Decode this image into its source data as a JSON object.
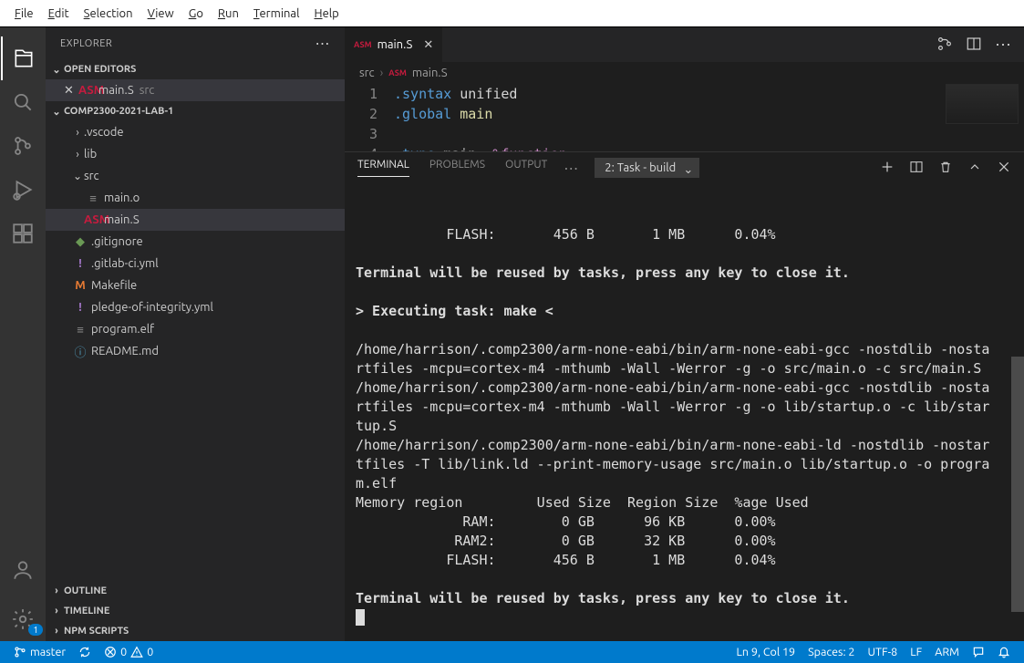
{
  "menubar": [
    "File",
    "Edit",
    "Selection",
    "View",
    "Go",
    "Run",
    "Terminal",
    "Help"
  ],
  "explorer": {
    "title": "EXPLORER",
    "openEditorsLabel": "OPEN EDITORS",
    "openEditors": [
      {
        "name": "main.S",
        "dir": "src",
        "iconClass": "ic-asm",
        "iconText": "ASM"
      }
    ],
    "rootName": "COMP2300-2021-LAB-1",
    "tree": [
      {
        "type": "folder",
        "name": ".vscode",
        "indent": 1,
        "expanded": false
      },
      {
        "type": "folder",
        "name": "lib",
        "indent": 1,
        "expanded": false
      },
      {
        "type": "folder",
        "name": "src",
        "indent": 1,
        "expanded": true
      },
      {
        "type": "file",
        "name": "main.o",
        "indent": 2,
        "iconClass": "ic-file",
        "iconText": "≡"
      },
      {
        "type": "file",
        "name": "main.S",
        "indent": 2,
        "iconClass": "ic-asm",
        "iconText": "ASM",
        "selected": true
      },
      {
        "type": "file",
        "name": ".gitignore",
        "indent": 1,
        "iconClass": "ic-git",
        "iconText": "◆"
      },
      {
        "type": "file",
        "name": ".gitlab-ci.yml",
        "indent": 1,
        "iconClass": "ic-yml",
        "iconText": "!"
      },
      {
        "type": "file",
        "name": "Makefile",
        "indent": 1,
        "iconClass": "ic-make",
        "iconText": "M"
      },
      {
        "type": "file",
        "name": "pledge-of-integrity.yml",
        "indent": 1,
        "iconClass": "ic-yml",
        "iconText": "!"
      },
      {
        "type": "file",
        "name": "program.elf",
        "indent": 1,
        "iconClass": "ic-file",
        "iconText": "≡"
      },
      {
        "type": "file",
        "name": "README.md",
        "indent": 1,
        "iconClass": "ic-info",
        "iconText": "ⓘ"
      }
    ],
    "bottomSections": [
      "OUTLINE",
      "TIMELINE",
      "NPM SCRIPTS"
    ]
  },
  "editor": {
    "tab": {
      "name": "main.S",
      "iconText": "ASM"
    },
    "breadcrumb": [
      "src",
      "main.S"
    ],
    "code": {
      "lines": [
        [
          {
            "t": ".syntax",
            "c": "tok-dir"
          },
          {
            "t": " unified",
            "c": "tok-plain"
          }
        ],
        [
          {
            "t": ".global",
            "c": "tok-dir"
          },
          {
            "t": " main",
            "c": "tok-id"
          }
        ],
        [],
        [
          {
            "t": ".type",
            "c": "tok-dir"
          },
          {
            "t": " main, ",
            "c": "tok-plain"
          },
          {
            "t": "%function",
            "c": "tok-kw"
          }
        ]
      ]
    }
  },
  "panel": {
    "tabs": [
      "TERMINAL",
      "PROBLEMS",
      "OUTPUT"
    ],
    "activeTab": 0,
    "select": "2: Task - build",
    "terminalLines": [
      "           FLASH:       456 B       1 MB      0.04%",
      "",
      "Terminal will be reused by tasks, press any key to close it.",
      "",
      "> Executing task: make <",
      "",
      "/home/harrison/.comp2300/arm-none-eabi/bin/arm-none-eabi-gcc -nostdlib -nostartfiles -mcpu=cortex-m4 -mthumb -Wall -Werror -g -o src/main.o -c src/main.S",
      "/home/harrison/.comp2300/arm-none-eabi/bin/arm-none-eabi-gcc -nostdlib -nostartfiles -mcpu=cortex-m4 -mthumb -Wall -Werror -g -o lib/startup.o -c lib/startup.S",
      "/home/harrison/.comp2300/arm-none-eabi/bin/arm-none-eabi-ld -nostdlib -nostartfiles -T lib/link.ld --print-memory-usage src/main.o lib/startup.o -o program.elf",
      "Memory region         Used Size  Region Size  %age Used",
      "             RAM:        0 GB      96 KB      0.00%",
      "            RAM2:        0 GB      32 KB      0.00%",
      "           FLASH:       456 B       1 MB      0.04%",
      "",
      "Terminal will be reused by tasks, press any key to close it."
    ],
    "boldLines": [
      2,
      4,
      14
    ]
  },
  "status": {
    "branch": "master",
    "errors": "0",
    "warnings": "0",
    "lnCol": "Ln 9, Col 19",
    "spaces": "Spaces: 2",
    "encoding": "UTF-8",
    "eol": "LF",
    "language": "ARM"
  }
}
